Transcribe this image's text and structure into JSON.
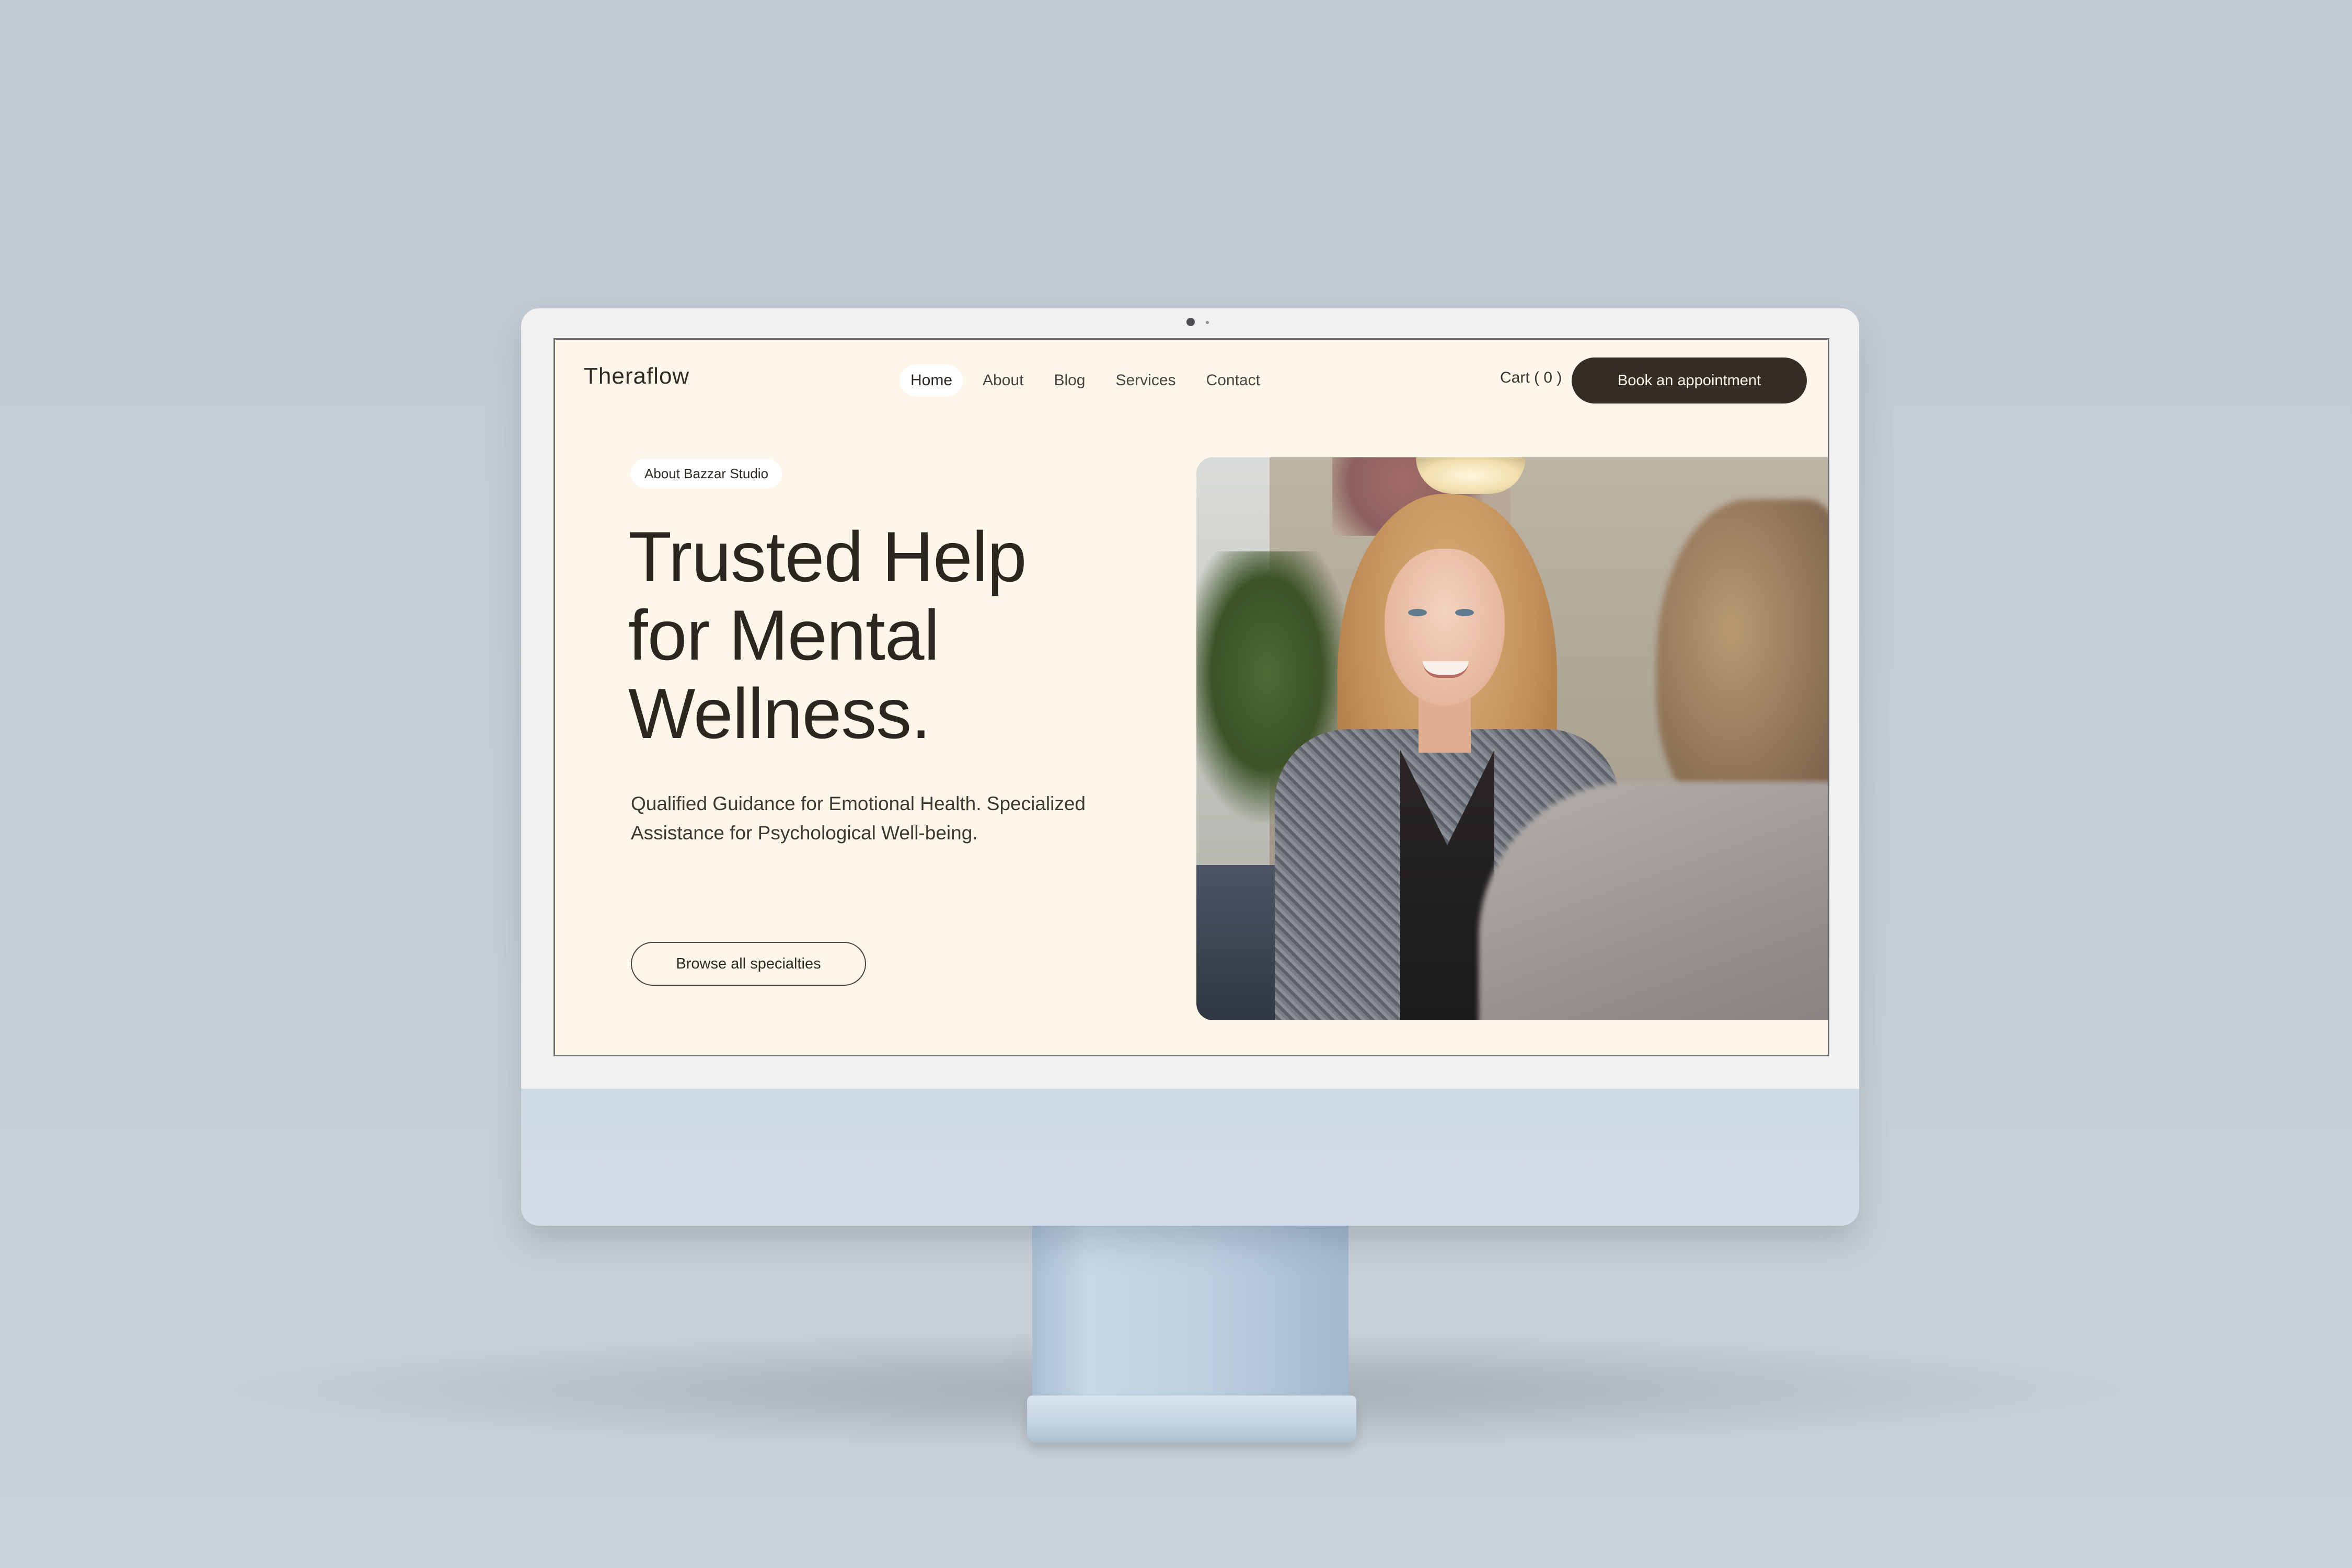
{
  "site": {
    "logo": "Theraflow",
    "nav": [
      {
        "label": "Home",
        "active": true
      },
      {
        "label": "About",
        "active": false
      },
      {
        "label": "Blog",
        "active": false
      },
      {
        "label": "Services",
        "active": false
      },
      {
        "label": "Contact",
        "active": false
      }
    ],
    "cart_label": "Cart ( 0 )",
    "book_label": "Book an appointment"
  },
  "hero": {
    "badge": "About Bazzar Studio",
    "headline": [
      "Trusted Help",
      "for Mental",
      "Wellness."
    ],
    "subtext": "Qualified Guidance for Emotional Health. Specialized Assistance for Psychological Well-being.",
    "browse_label": "Browse all specialties",
    "image_icon": "photo-therapy-session"
  },
  "colors": {
    "page_background": "#fdf7ea",
    "accent_dark": "#352c24",
    "text": "#2c2620",
    "device_background": "#c3cad3"
  }
}
